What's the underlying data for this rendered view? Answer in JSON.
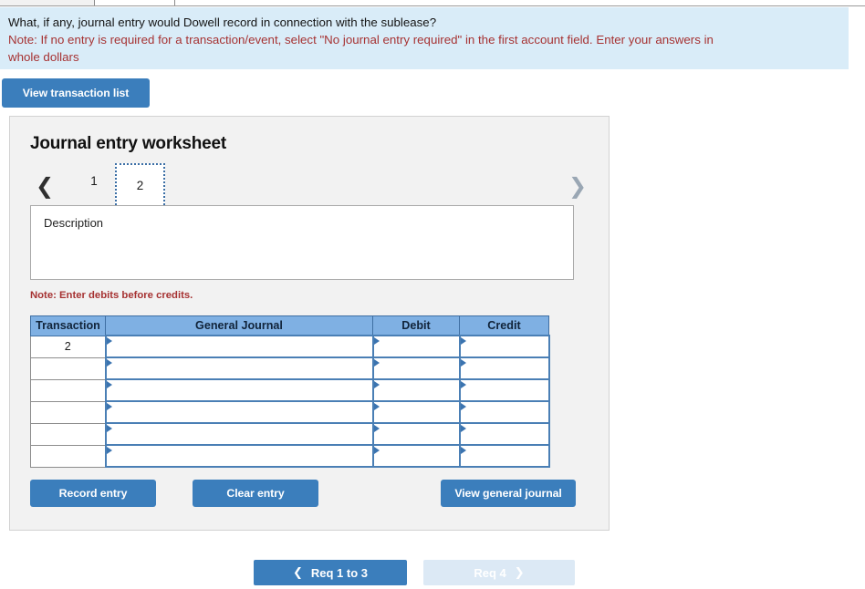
{
  "top_tabs": [
    {
      "name": "tab-1",
      "active": true
    },
    {
      "name": "tab-2",
      "active": false
    },
    {
      "name": "tab-3",
      "active": false
    }
  ],
  "banner": {
    "question": "What, if any, journal entry would Dowell record in connection with the sublease?",
    "note_line1": "Note: If no entry is required for a transaction/event, select \"No journal entry required\" in the first account field. Enter your answers in",
    "note_line2": "whole dollars",
    "background_color": "#d9ecf8",
    "note_color": "#a63232"
  },
  "toolbar": {
    "view_transaction_list_label": "View transaction list"
  },
  "worksheet": {
    "title": "Journal entry worksheet",
    "pager": {
      "prev_icon": "chevron-left-icon",
      "next_icon": "chevron-right-icon",
      "pages": [
        "1",
        "2"
      ],
      "active_page": "2"
    },
    "description": {
      "label": "Description",
      "value": ""
    },
    "note": "Note: Enter debits before credits.",
    "table": {
      "headers": [
        "Transaction",
        "General Journal",
        "Debit",
        "Credit"
      ],
      "header_color": "#7fb0e3",
      "rows": [
        {
          "transaction": "2",
          "general_journal": "",
          "debit": "",
          "credit": ""
        },
        {
          "transaction": "",
          "general_journal": "",
          "debit": "",
          "credit": ""
        },
        {
          "transaction": "",
          "general_journal": "",
          "debit": "",
          "credit": ""
        },
        {
          "transaction": "",
          "general_journal": "",
          "debit": "",
          "credit": ""
        },
        {
          "transaction": "",
          "general_journal": "",
          "debit": "",
          "credit": ""
        },
        {
          "transaction": "",
          "general_journal": "",
          "debit": "",
          "credit": ""
        }
      ]
    },
    "buttons": {
      "record_entry": "Record entry",
      "clear_entry": "Clear entry",
      "view_general_journal": "View general journal"
    }
  },
  "pagination": {
    "prev_label": "Req 1 to 3",
    "next_label": "Req 4",
    "prev_icon": "chevron-left-icon",
    "next_icon": "chevron-right-icon",
    "prev_color": "#3b7ebc",
    "next_color": "#dce9f5"
  }
}
